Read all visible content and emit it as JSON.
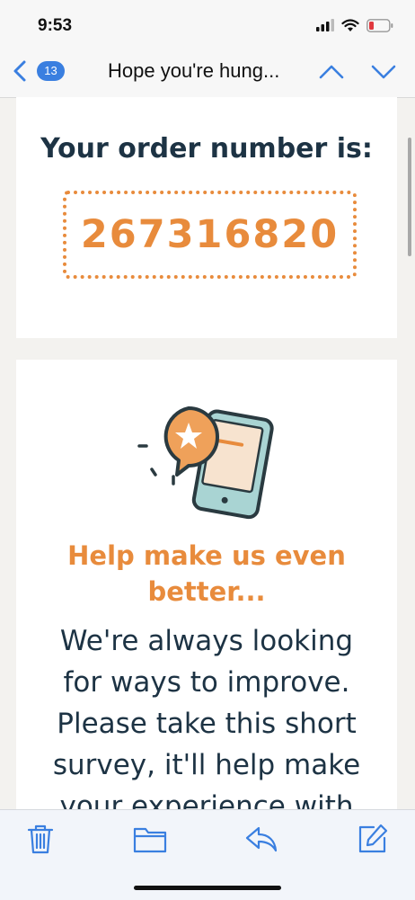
{
  "status": {
    "time": "9:53"
  },
  "nav": {
    "unread_count": "13",
    "subject": "Hope you're hung..."
  },
  "order": {
    "heading": "Your order number is:",
    "number": "267316820"
  },
  "survey": {
    "heading_line1": "Help make us even",
    "heading_line2": "better...",
    "body_line1": "We're always looking",
    "body_line2": "for ways to improve.",
    "body_line3": "Please take this short",
    "body_line4": "survey, it'll help make",
    "body_line5": "your experience with"
  },
  "toolbar": {
    "icons": [
      "trash-icon",
      "folder-icon",
      "reply-icon",
      "compose-icon"
    ]
  },
  "colors": {
    "accent": "#e88b3c",
    "text_dark": "#1d3344",
    "ios_blue": "#3a7fe0"
  }
}
